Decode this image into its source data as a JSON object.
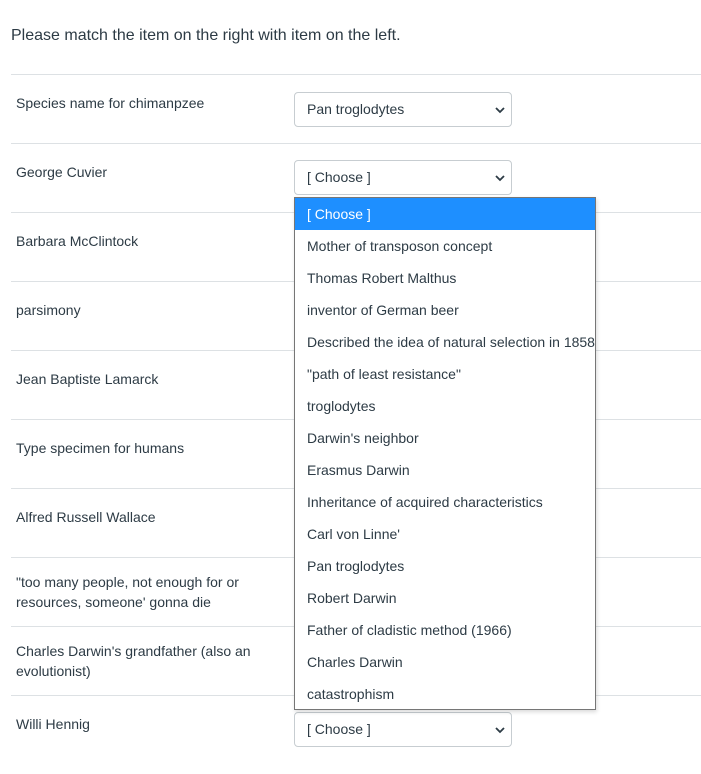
{
  "instructions": "Please match the item on the right with item on the left.",
  "rows": [
    {
      "label": "Species name for chimanpzee",
      "selected": "Pan troglodytes"
    },
    {
      "label": "George Cuvier",
      "selected": "[ Choose ]"
    },
    {
      "label": "Barbara McClintock",
      "selected": ""
    },
    {
      "label": "parsimony",
      "selected": ""
    },
    {
      "label": "Jean Baptiste Lamarck",
      "selected": ""
    },
    {
      "label": "Type specimen for humans",
      "selected": ""
    },
    {
      "label": "Alfred Russell Wallace",
      "selected": ""
    },
    {
      "label": "\"too many people, not enough for or resources, someone' gonna die",
      "selected": ""
    },
    {
      "label": "Charles Darwin's grandfather (also an evolutionist)",
      "selected": ""
    },
    {
      "label": "Willi Hennig",
      "selected": "[ Choose ]"
    }
  ],
  "dropdown_options": [
    "[ Choose ]",
    "Mother of transposon concept",
    "Thomas Robert Malthus",
    "inventor of German beer",
    "Described the idea of natural selection in 1858",
    "\"path of least resistance\"",
    "troglodytes",
    "Darwin's neighbor",
    "Erasmus Darwin",
    "Inheritance of acquired characteristics",
    "Carl von Linne'",
    "Pan troglodytes",
    "Robert Darwin",
    "Father of cladistic method (1966)",
    "Charles Darwin",
    "catastrophism"
  ],
  "highlighted_option": "[ Choose ]",
  "colors": {
    "highlight": "#1e8fff",
    "text": "#2d3b45",
    "divider": "#dde1e4"
  }
}
